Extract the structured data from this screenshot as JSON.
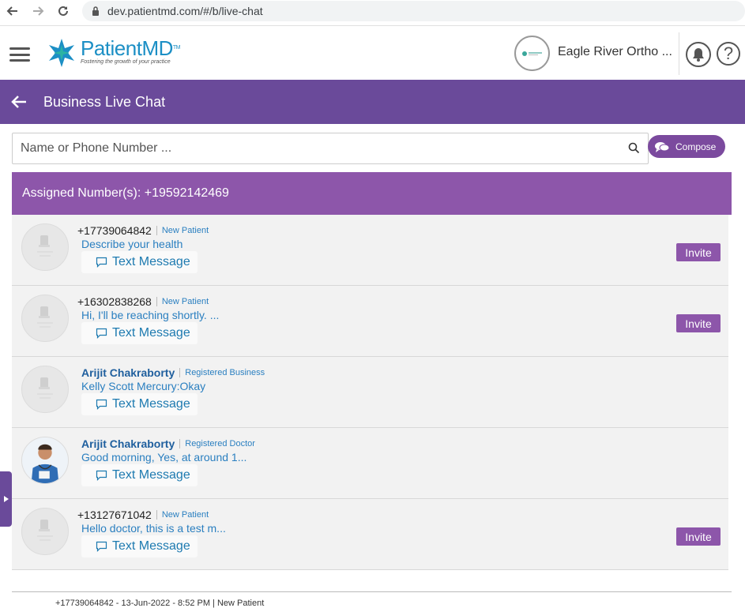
{
  "browser": {
    "url": "dev.patientmd.com/#/b/live-chat"
  },
  "header": {
    "logo_name": "PatientMD",
    "logo_tm": "TM",
    "logo_tagline": "Fostering the growth of your practice",
    "org_name": "Eagle River Ortho ...",
    "help_label": "?"
  },
  "titlebar": {
    "title": "Business Live Chat"
  },
  "search": {
    "placeholder": "Name or Phone Number ..."
  },
  "compose": {
    "label": "Compose"
  },
  "assigned": {
    "text": "Assigned Number(s): +19592142469"
  },
  "chats": [
    {
      "title": "+17739064842",
      "title_style": "phone",
      "type": "New Patient",
      "message": "Describe your health",
      "action": "Text Message",
      "invite": "Invite",
      "avatar": "placeholder"
    },
    {
      "title": "+16302838268",
      "title_style": "phone",
      "type": "New Patient",
      "message": "Hi, I'll be reaching shortly. ...",
      "action": "Text Message",
      "invite": "Invite",
      "avatar": "placeholder"
    },
    {
      "title": "Arijit Chakraborty",
      "title_style": "name",
      "type": "Registered Business",
      "message": "Kelly Scott Mercury:Okay",
      "action": "Text Message",
      "invite": "",
      "avatar": "placeholder"
    },
    {
      "title": "Arijit Chakraborty",
      "title_style": "name",
      "type": "Registered Doctor",
      "message": "Good morning, Yes, at around 1...",
      "action": "Text Message",
      "invite": "",
      "avatar": "doctor-photo"
    },
    {
      "title": "+13127671042",
      "title_style": "phone",
      "type": "New Patient",
      "message": "Hello doctor, this is a test m...",
      "action": "Text Message",
      "invite": "Invite",
      "avatar": "placeholder"
    }
  ],
  "footer": {
    "snippet": "+17739064842 - 13-Jun-2022 - 8:52 PM | New Patient"
  },
  "colors": {
    "title_bar": "#6a4a9a",
    "assigned_bar": "#8d56aa",
    "invite": "#8d56aa",
    "link_blue": "#2a7fc0"
  }
}
